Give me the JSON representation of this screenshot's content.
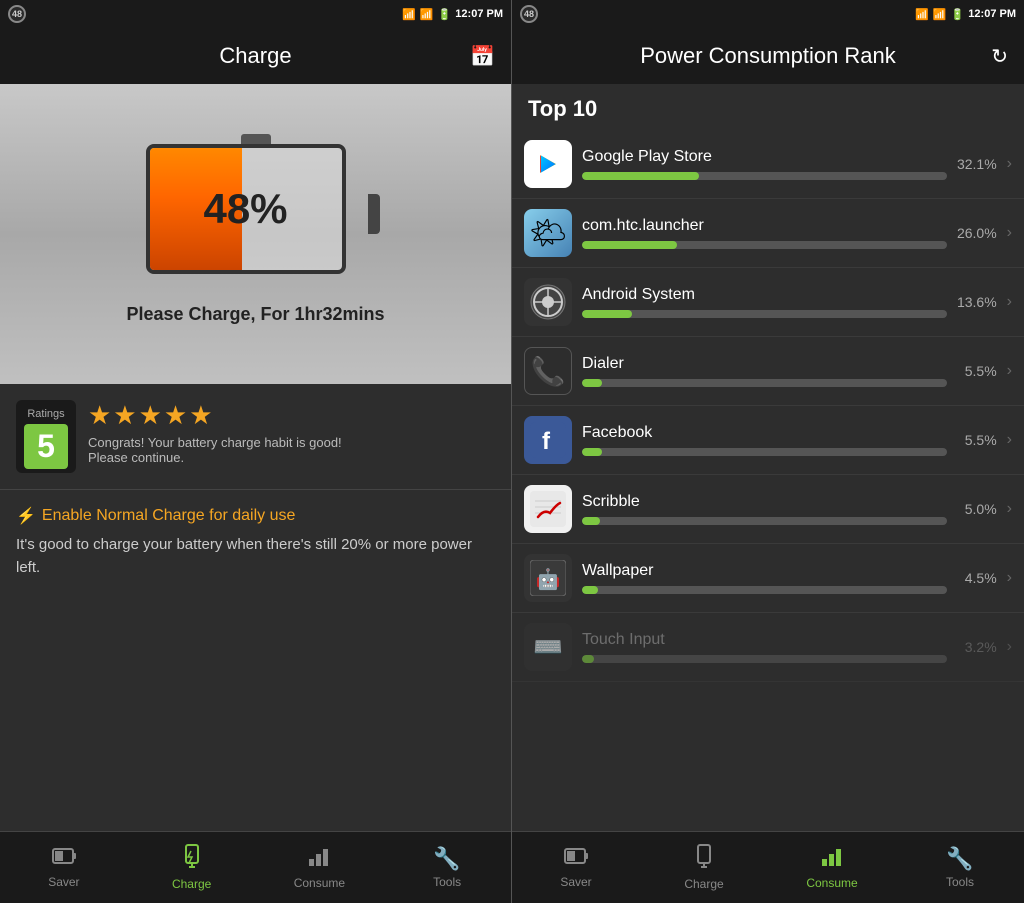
{
  "app": {
    "status_bar": {
      "notification_count": "48",
      "time": "12:07 PM"
    }
  },
  "left_panel": {
    "header": {
      "title": "Charge",
      "icon": "📅"
    },
    "battery": {
      "percent": "48%",
      "percent_fill": 48,
      "message": "Please Charge, For 1hr32mins"
    },
    "ratings": {
      "label": "Ratings",
      "score": "5",
      "stars": "★★★★★",
      "text": "Congrats! Your battery charge habit is good!\nPlease continue."
    },
    "tip": {
      "title": "⚡ Enable Normal Charge for daily use",
      "text": "It's good to charge your battery when there's still 20% or more power left."
    },
    "nav": [
      {
        "id": "saver",
        "label": "Saver",
        "icon": "🔋",
        "active": false
      },
      {
        "id": "charge",
        "label": "Charge",
        "icon": "🔌",
        "active": true
      },
      {
        "id": "consume",
        "label": "Consume",
        "icon": "📊",
        "active": false
      },
      {
        "id": "tools",
        "label": "Tools",
        "icon": "🔧",
        "active": false
      }
    ]
  },
  "right_panel": {
    "header": {
      "title": "Power Consumption Rank"
    },
    "top_label": "Top 10",
    "apps": [
      {
        "name": "Google Play Store",
        "percent": "32.1%",
        "bar": 32.1,
        "icon_type": "playstore"
      },
      {
        "name": "com.htc.launcher",
        "percent": "26.0%",
        "bar": 26.0,
        "icon_type": "weather"
      },
      {
        "name": "Android System",
        "percent": "13.6%",
        "bar": 13.6,
        "icon_type": "android-sys"
      },
      {
        "name": "Dialer",
        "percent": "5.5%",
        "bar": 5.5,
        "icon_type": "dialer"
      },
      {
        "name": "Facebook",
        "percent": "5.5%",
        "bar": 5.5,
        "icon_type": "facebook"
      },
      {
        "name": "Scribble",
        "percent": "5.0%",
        "bar": 5.0,
        "icon_type": "scribble"
      },
      {
        "name": "Wallpaper",
        "percent": "4.5%",
        "bar": 4.5,
        "icon_type": "wallpaper"
      },
      {
        "name": "Touch Input",
        "percent": "3.2%",
        "bar": 3.2,
        "icon_type": "android-sys"
      }
    ],
    "nav": [
      {
        "id": "saver",
        "label": "Saver",
        "icon": "🔋",
        "active": false
      },
      {
        "id": "charge",
        "label": "Charge",
        "icon": "🔌",
        "active": false
      },
      {
        "id": "consume",
        "label": "Consume",
        "icon": "📊",
        "active": true
      },
      {
        "id": "tools",
        "label": "Tools",
        "icon": "🔧",
        "active": false
      }
    ]
  }
}
